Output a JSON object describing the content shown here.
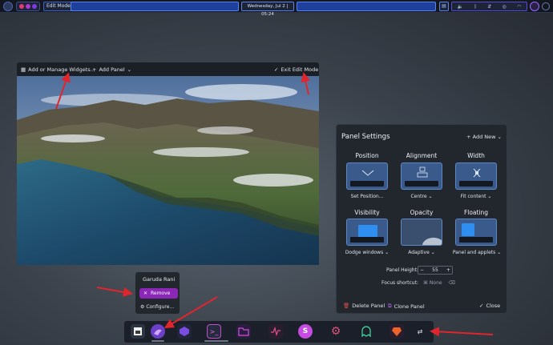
{
  "topbar": {
    "edit_mode_label": "Edit Mode",
    "clock": "Wednesday, Jul 2 | 05:24",
    "tray_icons": [
      "volume-icon",
      "wifi-icon",
      "bluetooth-icon",
      "network-icon",
      "power-icon"
    ]
  },
  "wallpaper_window": {
    "add_widgets_label": "Add or Manage Widgets...",
    "add_panel_label": "Add Panel",
    "exit_edit_label": "Exit Edit Mode"
  },
  "panel_settings": {
    "title": "Panel Settings",
    "add_new_label": "Add New",
    "sections": [
      {
        "heading": "Position",
        "value": "Set Position..."
      },
      {
        "heading": "Alignment",
        "value": "Centre"
      },
      {
        "heading": "Width",
        "value": "Fit content"
      },
      {
        "heading": "Visibility",
        "value": "Dodge windows"
      },
      {
        "heading": "Opacity",
        "value": "Adaptive"
      },
      {
        "heading": "Floating",
        "value": "Panel and applets"
      }
    ],
    "panel_height_label": "Panel Height:",
    "panel_height_value": "55",
    "focus_shortcut_label": "Focus shortcut:",
    "focus_shortcut_value": "None",
    "delete_label": "Delete Panel",
    "clone_label": "Clone Panel",
    "close_label": "Close"
  },
  "context_menu": {
    "title": "Garuda Rani",
    "remove_label": "Remove",
    "configure_label": "Configure..."
  },
  "colors": {
    "accent_purple": "#8a27b7",
    "tile_blue": "#3a5a8c",
    "arrow_red": "#e0262c"
  }
}
